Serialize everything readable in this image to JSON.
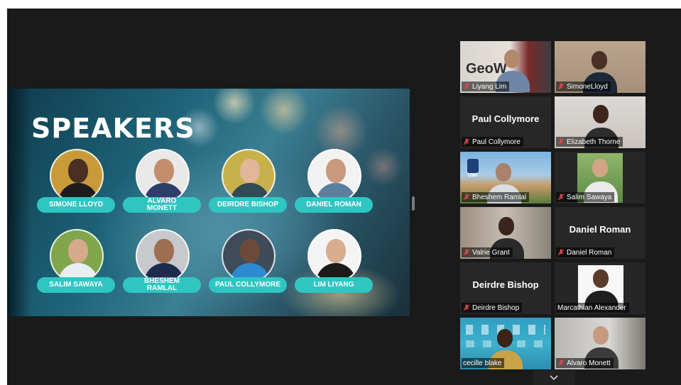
{
  "slide": {
    "title": "SPEAKERS",
    "speakers": [
      {
        "name": "SIMONE LLOYD"
      },
      {
        "name": "ALVARO MONETT"
      },
      {
        "name": "DEIRDRE BISHOP"
      },
      {
        "name": "DANIEL ROMAN"
      },
      {
        "name": "SALIM SAWAYA"
      },
      {
        "name": "BHESHEM RAMLAL"
      },
      {
        "name": "PAUL COLLYMORE"
      },
      {
        "name": "LIM LIYANG"
      }
    ],
    "colors": {
      "pill": "#2fc6c2",
      "title": "#ffffff"
    }
  },
  "gallery": {
    "tiles": [
      {
        "name": "Liyang Lim",
        "overlay_text": "GeoW",
        "muted": true
      },
      {
        "name": "SimoneLloyd",
        "muted": true
      },
      {
        "name": "Paul Collymore",
        "display_name": "Paul Collymore",
        "muted": true
      },
      {
        "name": "Elizabeth Thorne",
        "muted": true
      },
      {
        "name": "Bheshem Ramlal",
        "overlay_text": "UWI",
        "muted": true
      },
      {
        "name": "Salim Sawaya",
        "muted": true
      },
      {
        "name": "Valrie Grant",
        "muted": true
      },
      {
        "name": "Daniel Roman",
        "display_name": "Daniel Roman",
        "muted": true
      },
      {
        "name": "Deirdre Bishop",
        "display_name": "Deirdre Bishop",
        "muted": true
      },
      {
        "name": "Marcathlan Alexander",
        "muted": false
      },
      {
        "name": "cecille blake",
        "muted": false,
        "active_speaker": true
      },
      {
        "name": "Alvaro Monett",
        "muted": true
      }
    ],
    "colors": {
      "active_border": "#d7f04a",
      "muted_icon": "#e0474c"
    }
  },
  "controls": {
    "scroll_icon": "chevron-down-icon"
  }
}
